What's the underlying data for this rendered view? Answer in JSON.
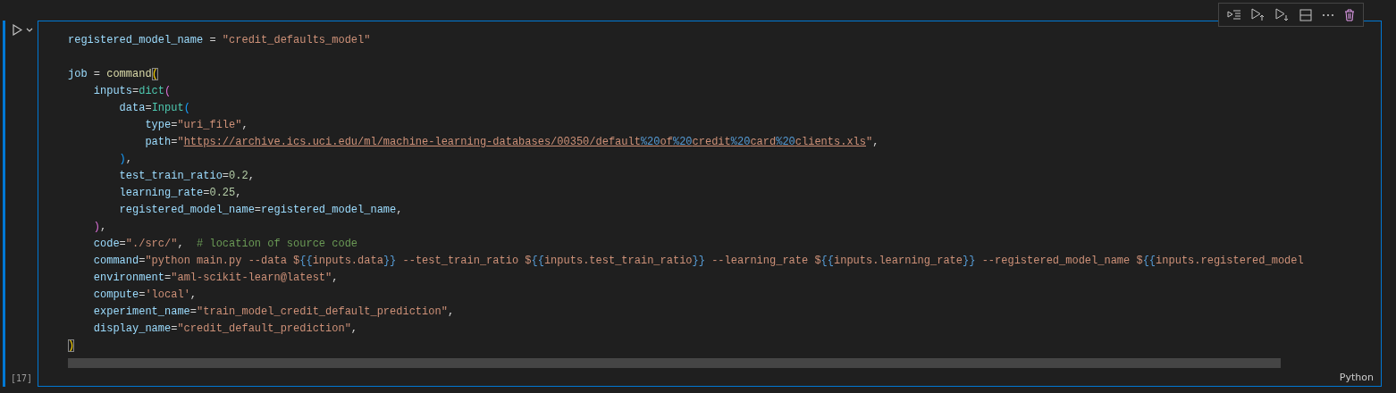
{
  "cell": {
    "execution_count": "[17]",
    "language": "Python",
    "lines": [
      {
        "kind": "code",
        "tokens": [
          {
            "text": "registered_model_name",
            "kind": "var"
          },
          {
            "text": " = ",
            "kind": "op"
          },
          {
            "text": "\"credit_defaults_model\"",
            "kind": "str"
          }
        ]
      },
      {
        "kind": "blank"
      },
      {
        "kind": "code",
        "tokens": [
          {
            "text": "job",
            "kind": "var"
          },
          {
            "text": " = ",
            "kind": "op"
          },
          {
            "text": "command",
            "kind": "func"
          },
          {
            "text": "(",
            "kind": "b1",
            "matched": true
          }
        ]
      },
      {
        "kind": "code",
        "tokens": [
          {
            "text": "    inputs",
            "kind": "var"
          },
          {
            "text": "=",
            "kind": "op"
          },
          {
            "text": "dict",
            "kind": "cls"
          },
          {
            "text": "(",
            "kind": "b2"
          }
        ]
      },
      {
        "kind": "code",
        "tokens": [
          {
            "text": "        data",
            "kind": "var"
          },
          {
            "text": "=",
            "kind": "op"
          },
          {
            "text": "Input",
            "kind": "cls"
          },
          {
            "text": "(",
            "kind": "b3"
          }
        ]
      },
      {
        "kind": "code",
        "tokens": [
          {
            "text": "            type",
            "kind": "var"
          },
          {
            "text": "=",
            "kind": "op"
          },
          {
            "text": "\"uri_file\"",
            "kind": "str"
          },
          {
            "text": ",",
            "kind": "op"
          }
        ]
      },
      {
        "kind": "code",
        "tokens": [
          {
            "text": "            path",
            "kind": "var"
          },
          {
            "text": "=",
            "kind": "op"
          },
          {
            "text": "\"",
            "kind": "str"
          },
          {
            "text": "https://archive.ics.uci.edu/ml/machine-learning-databases/00350/default",
            "kind": "link"
          },
          {
            "text": "%20",
            "kind": "linkesc"
          },
          {
            "text": "of",
            "kind": "link"
          },
          {
            "text": "%20",
            "kind": "linkesc"
          },
          {
            "text": "credit",
            "kind": "link"
          },
          {
            "text": "%20",
            "kind": "linkesc"
          },
          {
            "text": "card",
            "kind": "link"
          },
          {
            "text": "%20",
            "kind": "linkesc"
          },
          {
            "text": "clients.xls",
            "kind": "link"
          },
          {
            "text": "\"",
            "kind": "str"
          },
          {
            "text": ",",
            "kind": "op"
          }
        ]
      },
      {
        "kind": "code",
        "tokens": [
          {
            "text": "        )",
            "kind": "b3"
          },
          {
            "text": ",",
            "kind": "op"
          }
        ]
      },
      {
        "kind": "code",
        "tokens": [
          {
            "text": "        test_train_ratio",
            "kind": "var"
          },
          {
            "text": "=",
            "kind": "op"
          },
          {
            "text": "0.2",
            "kind": "num"
          },
          {
            "text": ",",
            "kind": "op"
          }
        ]
      },
      {
        "kind": "code",
        "tokens": [
          {
            "text": "        learning_rate",
            "kind": "var"
          },
          {
            "text": "=",
            "kind": "op"
          },
          {
            "text": "0.25",
            "kind": "num"
          },
          {
            "text": ",",
            "kind": "op"
          }
        ]
      },
      {
        "kind": "code",
        "tokens": [
          {
            "text": "        registered_model_name",
            "kind": "var"
          },
          {
            "text": "=",
            "kind": "op"
          },
          {
            "text": "registered_model_name",
            "kind": "var"
          },
          {
            "text": ",",
            "kind": "op"
          }
        ]
      },
      {
        "kind": "code",
        "tokens": [
          {
            "text": "    )",
            "kind": "b2"
          },
          {
            "text": ",",
            "kind": "op"
          }
        ]
      },
      {
        "kind": "code",
        "tokens": [
          {
            "text": "    code",
            "kind": "var"
          },
          {
            "text": "=",
            "kind": "op"
          },
          {
            "text": "\"./src/\"",
            "kind": "str"
          },
          {
            "text": ",  ",
            "kind": "op"
          },
          {
            "text": "# location of source code",
            "kind": "comment"
          }
        ]
      },
      {
        "kind": "code",
        "tokens": [
          {
            "text": "    command",
            "kind": "var"
          },
          {
            "text": "=",
            "kind": "op"
          },
          {
            "text": "\"python main.py --data $",
            "kind": "str"
          },
          {
            "text": "{{",
            "kind": "esc"
          },
          {
            "text": "inputs.data",
            "kind": "str"
          },
          {
            "text": "}}",
            "kind": "esc"
          },
          {
            "text": " --test_train_ratio $",
            "kind": "str"
          },
          {
            "text": "{{",
            "kind": "esc"
          },
          {
            "text": "inputs.test_train_ratio",
            "kind": "str"
          },
          {
            "text": "}}",
            "kind": "esc"
          },
          {
            "text": " --learning_rate $",
            "kind": "str"
          },
          {
            "text": "{{",
            "kind": "esc"
          },
          {
            "text": "inputs.learning_rate",
            "kind": "str"
          },
          {
            "text": "}}",
            "kind": "esc"
          },
          {
            "text": " --registered_model_name $",
            "kind": "str"
          },
          {
            "text": "{{",
            "kind": "esc"
          },
          {
            "text": "inputs.registered_model",
            "kind": "str"
          }
        ]
      },
      {
        "kind": "code",
        "tokens": [
          {
            "text": "    environment",
            "kind": "var"
          },
          {
            "text": "=",
            "kind": "op"
          },
          {
            "text": "\"aml-scikit-learn@latest\"",
            "kind": "str"
          },
          {
            "text": ",",
            "kind": "op"
          }
        ]
      },
      {
        "kind": "code",
        "tokens": [
          {
            "text": "    compute",
            "kind": "var"
          },
          {
            "text": "=",
            "kind": "op"
          },
          {
            "text": "'local'",
            "kind": "str"
          },
          {
            "text": ",",
            "kind": "op"
          }
        ]
      },
      {
        "kind": "code",
        "tokens": [
          {
            "text": "    experiment_name",
            "kind": "var"
          },
          {
            "text": "=",
            "kind": "op"
          },
          {
            "text": "\"train_model_credit_default_prediction\"",
            "kind": "str"
          },
          {
            "text": ",",
            "kind": "op"
          }
        ]
      },
      {
        "kind": "code",
        "tokens": [
          {
            "text": "    display_name",
            "kind": "var"
          },
          {
            "text": "=",
            "kind": "op"
          },
          {
            "text": "\"credit_default_prediction\"",
            "kind": "str"
          },
          {
            "text": ",",
            "kind": "op"
          }
        ]
      },
      {
        "kind": "code",
        "tokens": [
          {
            "text": ")",
            "kind": "b1",
            "matched": true
          }
        ]
      }
    ]
  }
}
